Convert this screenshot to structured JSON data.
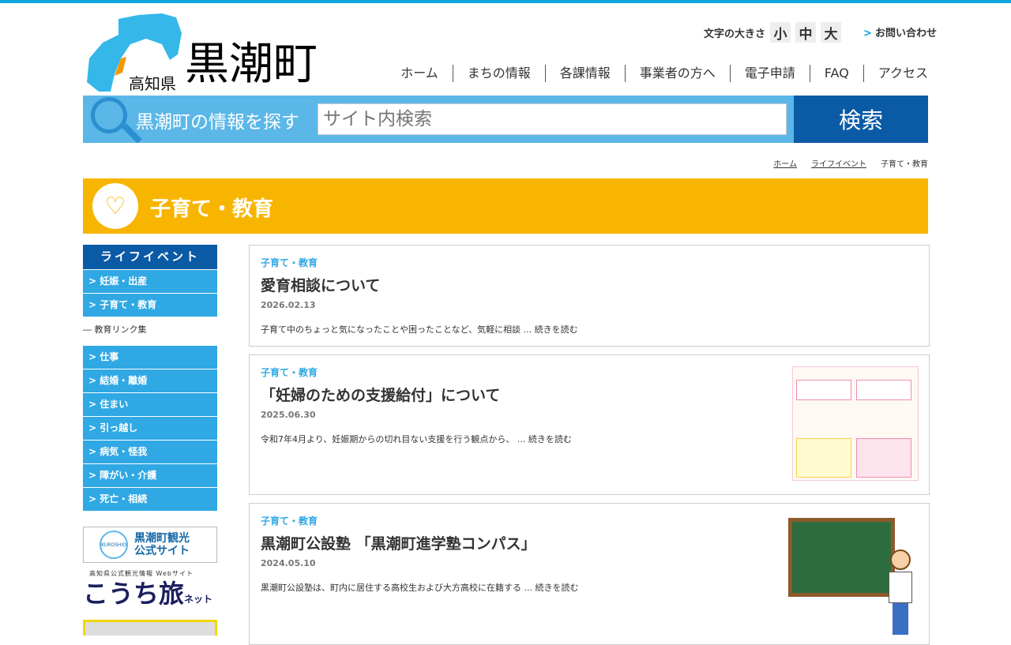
{
  "header": {
    "prefecture": "高知県",
    "town": "黒潮町",
    "font_size_label": "文字の大きさ",
    "font_sizes": [
      "小",
      "中",
      "大"
    ],
    "contact": "お問い合わせ",
    "contact_arrow": ">"
  },
  "nav": [
    "ホーム",
    "まちの情報",
    "各課情報",
    "事業者の方へ",
    "電子申請",
    "FAQ",
    "アクセス"
  ],
  "search": {
    "label": "黒潮町の情報を探す",
    "placeholder": "サイト内検索",
    "button": "検索"
  },
  "breadcrumb": [
    "ホーム",
    "ライフイベント",
    "子育て・教育"
  ],
  "page_title": "子育て・教育",
  "sidebar": {
    "heading": "ライフイベント",
    "items_top": [
      "> 妊娠・出産",
      "> 子育て・教育"
    ],
    "sub": "― 教育リンク集",
    "items": [
      "> 仕事",
      "> 結婚・離婚",
      "> 住まい",
      "> 引っ越し",
      "> 病気・怪我",
      "> 障がい・介護",
      "> 死亡・相続"
    ],
    "banner1": [
      "黒潮町観光",
      "公式サイト"
    ],
    "banner1_logo": "KUROSHIO",
    "banner2_sub": "高知県公式観光情報 Webサイト",
    "banner2": "こうち旅",
    "banner2_small": "ネット"
  },
  "articles": [
    {
      "category": "子育て・教育",
      "title": "愛育相談について",
      "date": "2026.02.13",
      "excerpt": "子育て中のちょっと気になったことや困ったことなど、気軽に相談 ... 続きを読む"
    },
    {
      "category": "子育て・教育",
      "title": "「妊婦のための支援給付」について",
      "date": "2025.06.30",
      "excerpt": "令和7年4月より、妊娠期からの切れ目ない支援を行う観点から、 ... 続きを読む"
    },
    {
      "category": "子育て・教育",
      "title": "黒潮町公設塾 「黒潮町進学塾コンパス」",
      "date": "2024.05.10",
      "excerpt": "黒潮町公設塾は、町内に居住する高校生および大方高校に在籍する ... 続きを読む"
    }
  ]
}
